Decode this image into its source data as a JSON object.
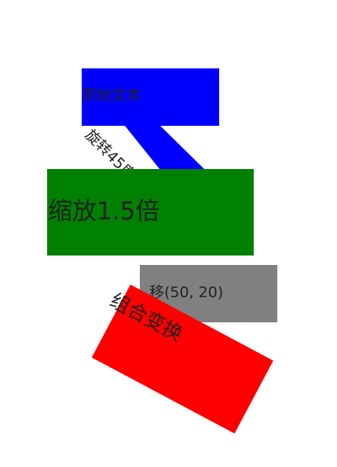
{
  "labels": {
    "original": "原始文本",
    "rotated": "旋转45度",
    "scaled": "缩放1.5倍",
    "translated": "移(50, 20)",
    "combined": "组合变换"
  },
  "colors": {
    "blue": "#0000ff",
    "green": "#008000",
    "gray": "#808080",
    "red": "#ff0000",
    "text": "#222222",
    "background": "#ffffff"
  }
}
